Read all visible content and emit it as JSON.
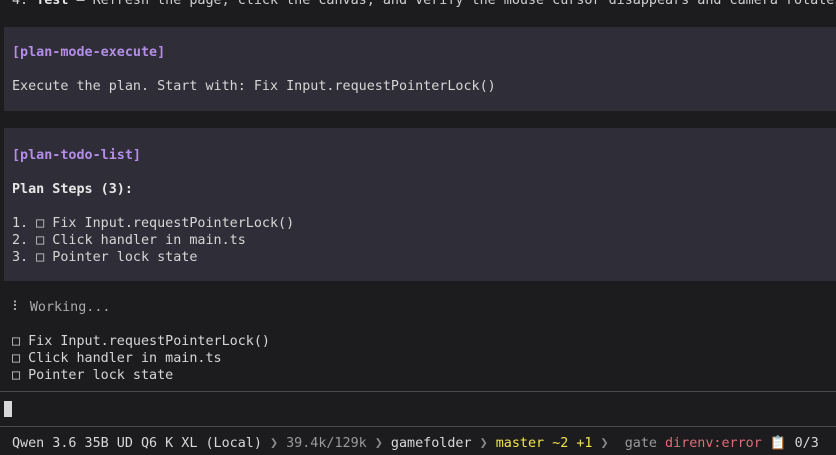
{
  "top_line": {
    "prefix": "4. ",
    "bold": "Test",
    "rest": " — Refresh the page, click the canvas, and verify the mouse cursor disappears and camera rotates"
  },
  "exec_block": {
    "tag": "[plan-mode-execute]",
    "text": "Execute the plan. Start with: Fix Input.requestPointerLock()"
  },
  "todo_block": {
    "tag": "[plan-todo-list]",
    "heading": "Plan Steps (3):",
    "steps": [
      "1. □ Fix Input.requestPointerLock()",
      "2. □ Click handler in main.ts",
      "3. □ Pointer lock state"
    ]
  },
  "working": {
    "spinner": "⠇",
    "label": "Working..."
  },
  "todo_items": [
    "□ Fix Input.requestPointerLock()",
    "□ Click handler in main.ts",
    "□ Pointer lock state"
  ],
  "status_bar": {
    "model": "Qwen 3.6 35B UD Q6 K XL (Local)",
    "sep": " ❯ ",
    "tokens": "39.4k/129k",
    "folder": "gamefolder",
    "branch": "master ~2 +1",
    "gate_icon": "",
    "gate": "gate",
    "direnv": "direnv:error",
    "clipboard_icon": "📋",
    "progress": "0/3"
  }
}
